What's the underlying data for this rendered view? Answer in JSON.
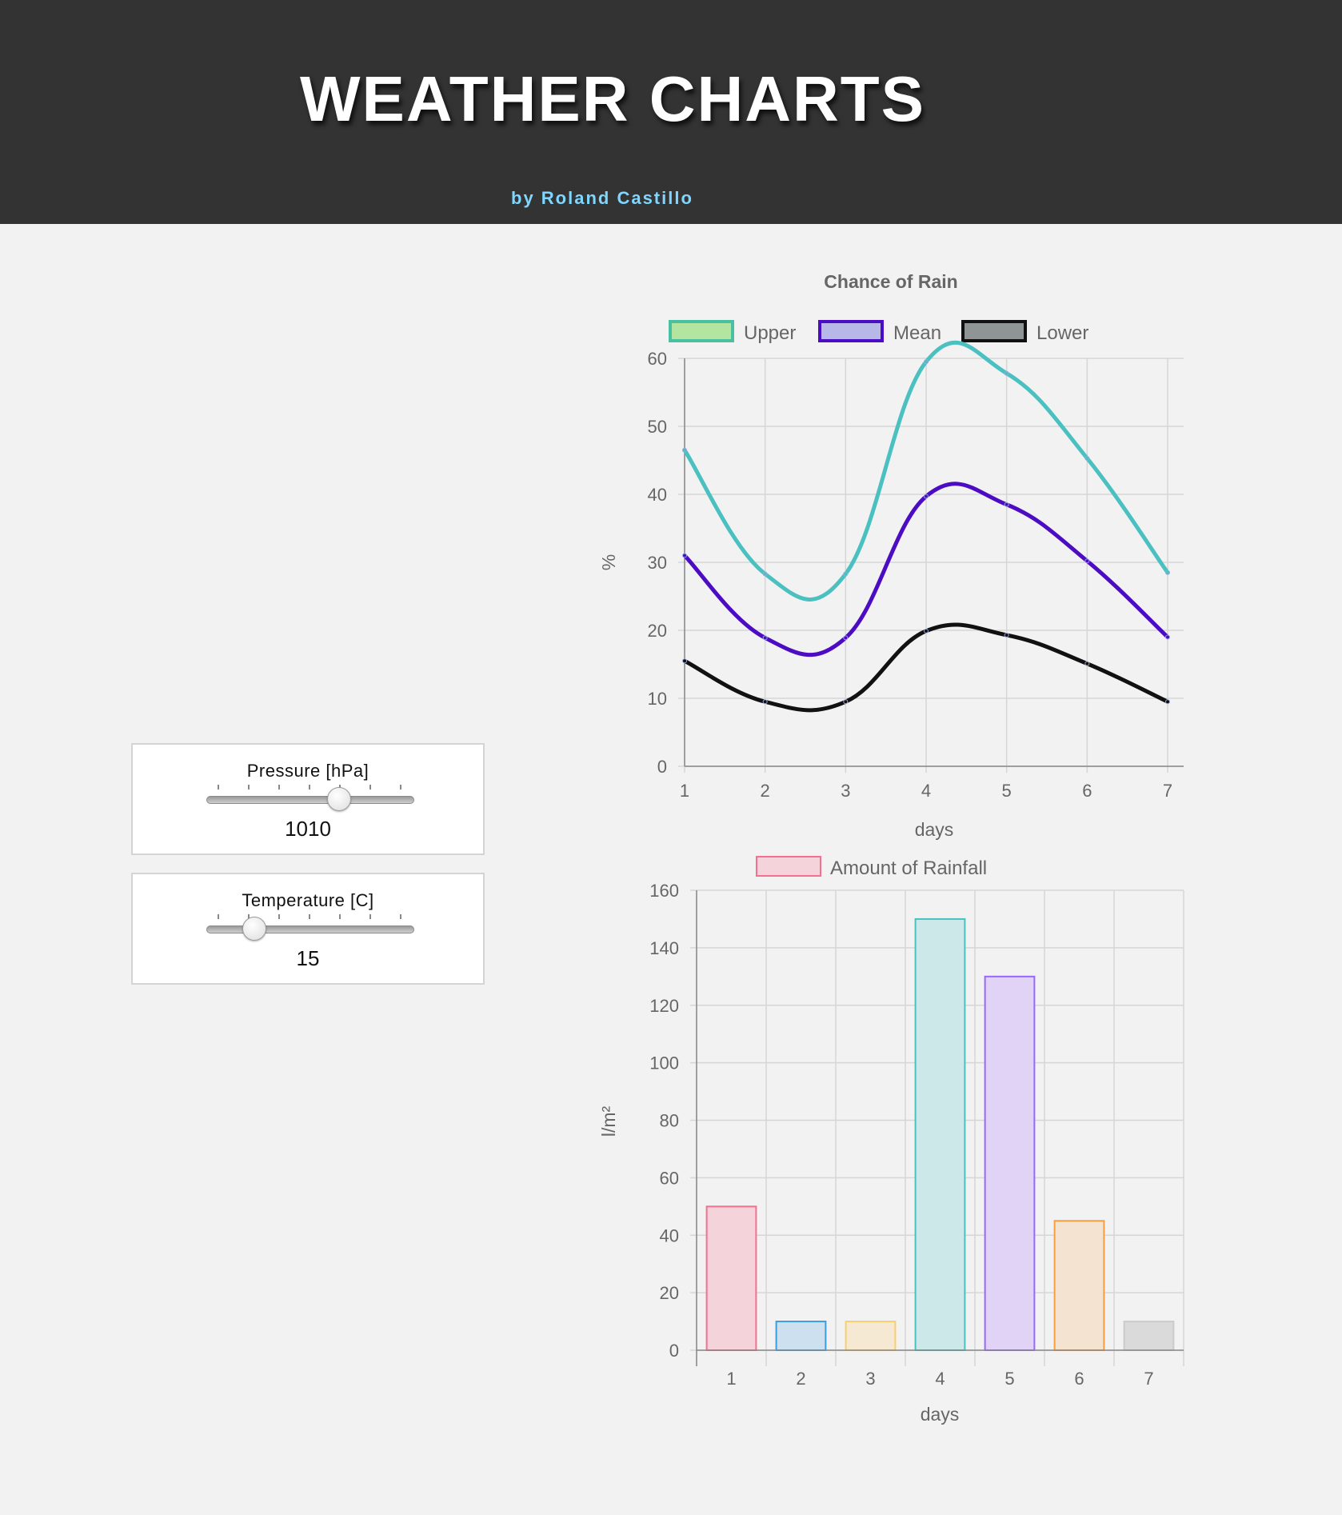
{
  "header": {
    "title": "WEATHER CHARTS",
    "byline": "by Roland Castillo"
  },
  "controls": {
    "pressure": {
      "label": "Pressure [hPa]",
      "value": "1010",
      "fraction": 0.64
    },
    "temperature": {
      "label": "Temperature [C]",
      "value": "15",
      "fraction": 0.23
    }
  },
  "colors": {
    "header_bg": "#333333",
    "byline": "#7fd6ff",
    "upper": "#4bc0c0",
    "mean": "#4b0cc4",
    "lower": "#111111"
  },
  "chart_data": [
    {
      "type": "line",
      "title": "Chance of Rain",
      "xlabel": "days",
      "ylabel": "%",
      "x": [
        1,
        2,
        3,
        4,
        5,
        6,
        7
      ],
      "ylim": [
        0,
        60
      ],
      "yticks": [
        0,
        10,
        20,
        30,
        40,
        50,
        60
      ],
      "grid": true,
      "legend": "top",
      "series": [
        {
          "name": "Upper",
          "values": [
            46.5,
            28.3,
            28.3,
            59.5,
            57.8,
            45.3,
            28.5
          ],
          "line": "#4bc0c0",
          "swatch": "#b3e5a1",
          "swatch_border": "#4bc0a0"
        },
        {
          "name": "Mean",
          "values": [
            31.0,
            18.9,
            18.9,
            39.7,
            38.5,
            30.2,
            19.0
          ],
          "line": "#4b0cc4",
          "swatch": "#b7b8e8",
          "swatch_border": "#4b0cc4"
        },
        {
          "name": "Lower",
          "values": [
            15.5,
            9.5,
            9.5,
            19.9,
            19.3,
            15.1,
            9.5
          ],
          "line": "#111111",
          "swatch": "#8f9495",
          "swatch_border": "#111111"
        }
      ]
    },
    {
      "type": "bar",
      "xlabel": "days",
      "ylabel": "l/m²",
      "categories": [
        "1",
        "2",
        "3",
        "4",
        "5",
        "6",
        "7"
      ],
      "values": [
        50,
        10,
        10,
        150,
        130,
        45,
        10
      ],
      "ylim": [
        0,
        160
      ],
      "yticks": [
        0,
        20,
        40,
        60,
        80,
        100,
        120,
        140,
        160
      ],
      "grid": true,
      "legend": "top",
      "series": [
        {
          "name": "Amount of Rainfall",
          "values": [
            50,
            10,
            10,
            150,
            130,
            45,
            10
          ]
        }
      ],
      "bar_fill": [
        "#f5d3da",
        "#cce0ef",
        "#f6e9d3",
        "#cde8e8",
        "#e0d3f5",
        "#f5e3d1",
        "#dadada"
      ],
      "bar_stroke": [
        "#f3708e",
        "#3c9ddc",
        "#f7cf6e",
        "#4bc0c0",
        "#9966ff",
        "#f79f40",
        "#c9cbcf"
      ]
    }
  ]
}
